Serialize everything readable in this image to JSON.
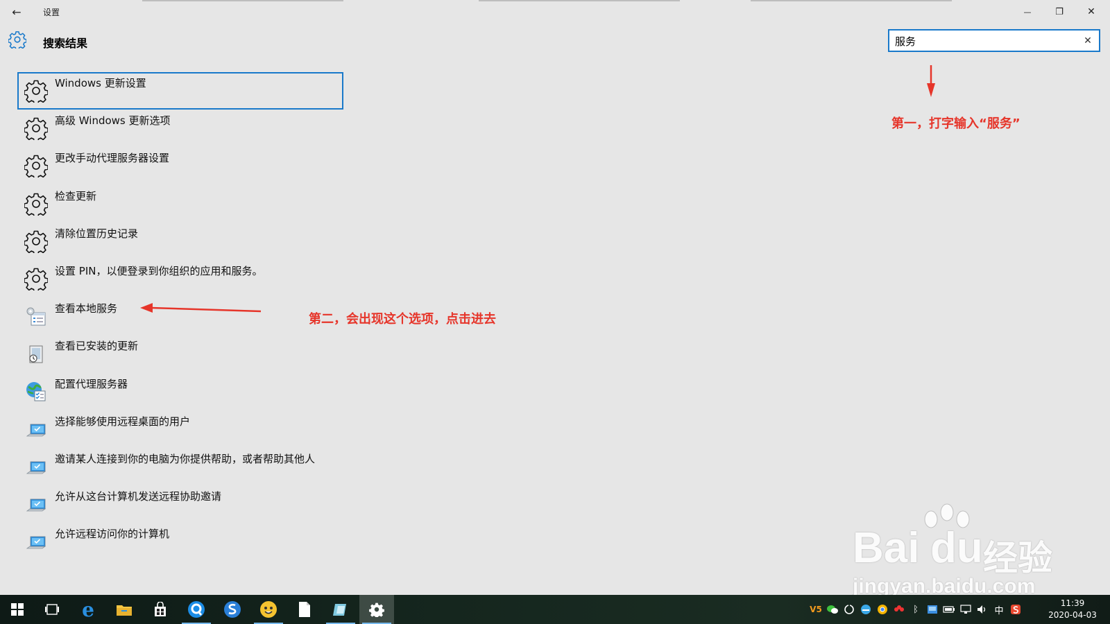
{
  "window": {
    "title": "设置",
    "back_glyph": "←",
    "minimize_glyph": "—",
    "maximize_glyph": "❐",
    "close_glyph": "✕"
  },
  "header": {
    "title": "搜索结果",
    "icon": "gear-icon"
  },
  "search": {
    "value": "服务",
    "clear_glyph": "✕",
    "border_color": "#1979ca"
  },
  "results": [
    {
      "label": "Windows 更新设置",
      "icon": "gear-icon",
      "selected": true
    },
    {
      "label": "高级 Windows 更新选项",
      "icon": "gear-icon"
    },
    {
      "label": "更改手动代理服务器设置",
      "icon": "gear-icon"
    },
    {
      "label": "检查更新",
      "icon": "gear-icon"
    },
    {
      "label": "清除位置历史记录",
      "icon": "gear-icon"
    },
    {
      "label": "设置 PIN，以便登录到你组织的应用和服务。",
      "icon": "gear-icon"
    },
    {
      "label": "查看本地服务",
      "icon": "services-icon"
    },
    {
      "label": "查看已安装的更新",
      "icon": "installed-updates-icon"
    },
    {
      "label": "配置代理服务器",
      "icon": "globe-settings-icon"
    },
    {
      "label": "选择能够使用远程桌面的用户",
      "icon": "remote-desktop-icon"
    },
    {
      "label": "邀请某人连接到你的电脑为你提供帮助，或者帮助其他人",
      "icon": "remote-desktop-icon"
    },
    {
      "label": "允许从这台计算机发送远程协助邀请",
      "icon": "remote-desktop-icon"
    },
    {
      "label": "允许远程访问你的计算机",
      "icon": "remote-desktop-icon"
    }
  ],
  "annotations": {
    "first": "第一，打字输入“服务”",
    "second": "第二，会出现这个选项，点击进去",
    "color": "#e6352a"
  },
  "watermark": {
    "brand": "Bai",
    "brand2": "du",
    "cn": "经验",
    "url": "jingyan.baidu.com"
  },
  "taskbar": {
    "apps": [
      "start-icon",
      "task-view-icon",
      "edge-icon",
      "file-explorer-icon",
      "store-icon",
      "browser-q-icon",
      "sogou-icon",
      "qq-emoji-icon",
      "notepad-icon",
      "app-icon",
      "settings-icon"
    ],
    "tray": {
      "ime": "中",
      "time": "11:39",
      "date": "2020-04-03"
    }
  },
  "colors": {
    "accent": "#1979ca",
    "background": "#e6e6e6",
    "annotation": "#e6352a"
  }
}
